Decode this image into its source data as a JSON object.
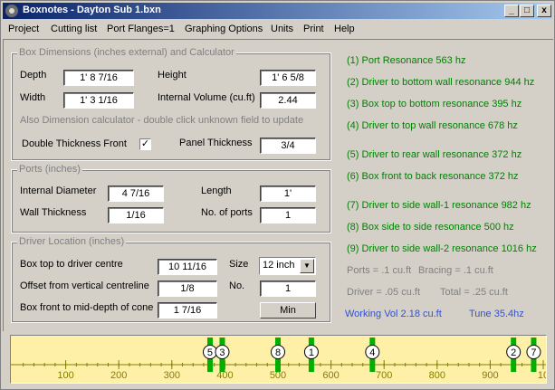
{
  "window": {
    "title": "Boxnotes - Dayton Sub 1.bxn",
    "buttons": {
      "minimize": "_",
      "maximize": "□",
      "close": "x"
    }
  },
  "menu": [
    "Project",
    "Cutting list",
    "Port Flanges=1",
    "Graphing Options",
    "Units",
    "Print",
    "Help"
  ],
  "box": {
    "title": "Box Dimensions (inches external) and Calculator",
    "depth_label": "Depth",
    "depth_value": "1' 8 7/16",
    "width_label": "Width",
    "width_value": "1' 3 1/16",
    "height_label": "Height",
    "height_value": "1' 6 5/8",
    "volume_label": "Internal Volume (cu.ft)",
    "volume_value": "2.44",
    "calc_note": "Also Dimension calculator - double click unknown field to update",
    "double_label": "Double Thickness Front",
    "double_checked": "✓",
    "panel_label": "Panel Thickness",
    "panel_value": "3/4"
  },
  "ports": {
    "title": "Ports (inches)",
    "diam_label": "Internal Diameter",
    "diam_value": "4 7/16",
    "length_label": "Length",
    "length_value": "1'",
    "wall_label": "Wall Thickness",
    "wall_value": "1/16",
    "count_label": "No. of ports",
    "count_value": "1"
  },
  "driver": {
    "title": "Driver Location (inches)",
    "top_label": "Box top to driver centre",
    "top_value": "10 11/16",
    "offset_label": "Offset from vertical centreline",
    "offset_value": "1/8",
    "front_label": "Box front to mid-depth of cone",
    "front_value": "1 7/16",
    "size_label": "Size",
    "size_value": "12 inch",
    "no_label": "No.",
    "no_value": "1",
    "min_button": "Min"
  },
  "resonances": [
    "(1) Port Resonance  563 hz",
    "(2) Driver to bottom wall resonance  944 hz",
    "(3) Box top to bottom resonance  395 hz",
    "(4) Driver to top wall resonance  678 hz",
    "(5) Driver to rear wall resonance 372 hz",
    "(6) Box front to back resonance  372 hz",
    "(7) Driver to side wall-1 resonance  982 hz",
    "(8) Box side to side resonance  500 hz",
    "(9) Driver to side wall-2 resonance  1016 hz"
  ],
  "volumes": {
    "ports": "Ports = .1 cu.ft",
    "bracing": "Bracing = .1 cu.ft",
    "driver": "Driver =  .05 cu.ft",
    "total": "Total =  .25 cu.ft",
    "working": "Working Vol  2.18 cu.ft",
    "tune": "Tune  35.4hz"
  },
  "colors": {
    "result": "#008000",
    "working": "#3050d8",
    "graph_bg": "#fff0a8",
    "marker": "#00b000"
  },
  "graph": {
    "ticks": [
      "100",
      "200",
      "300",
      "400",
      "500",
      "600",
      "700",
      "800",
      "900",
      "10"
    ],
    "markers": [
      {
        "label": "5",
        "hz": 372
      },
      {
        "label": "3",
        "hz": 395
      },
      {
        "label": "8",
        "hz": 500
      },
      {
        "label": "1",
        "hz": 563
      },
      {
        "label": "4",
        "hz": 678
      },
      {
        "label": "2",
        "hz": 944
      },
      {
        "label": "7",
        "hz": 982
      }
    ]
  }
}
